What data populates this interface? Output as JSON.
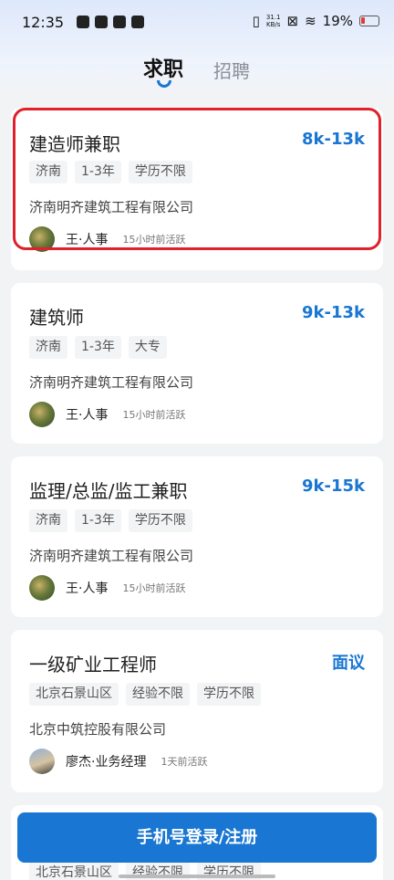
{
  "status_bar": {
    "time": "12:35",
    "net_speed_value": "31.1",
    "net_speed_unit": "KB/s",
    "battery": "19%"
  },
  "tabs": {
    "active": "求职",
    "inactive": "招聘"
  },
  "jobs": [
    {
      "title": "建造师兼职",
      "salary": "8k-13k",
      "tags": [
        "济南",
        "1-3年",
        "学历不限"
      ],
      "company": "济南明齐建筑工程有限公司",
      "recruiter": "王·人事",
      "active": "15小时前活跃"
    },
    {
      "title": "建筑师",
      "salary": "9k-13k",
      "tags": [
        "济南",
        "1-3年",
        "大专"
      ],
      "company": "济南明齐建筑工程有限公司",
      "recruiter": "王·人事",
      "active": "15小时前活跃"
    },
    {
      "title": "监理/总监/监工兼职",
      "salary": "9k-15k",
      "tags": [
        "济南",
        "1-3年",
        "学历不限"
      ],
      "company": "济南明齐建筑工程有限公司",
      "recruiter": "王·人事",
      "active": "15小时前活跃"
    },
    {
      "title": "一级矿业工程师",
      "salary": "面议",
      "tags": [
        "北京石景山区",
        "经验不限",
        "学历不限"
      ],
      "company": "北京中筑控股有限公司",
      "recruiter": "廖杰·业务经理",
      "active": "1天前活跃"
    }
  ],
  "peek_tags": [
    "北京石景山区",
    "经验不限",
    "学历不限"
  ],
  "cta": {
    "label": "手机号登录/注册"
  },
  "colors": {
    "accent": "#1976d2",
    "highlight": "#e0202a"
  }
}
